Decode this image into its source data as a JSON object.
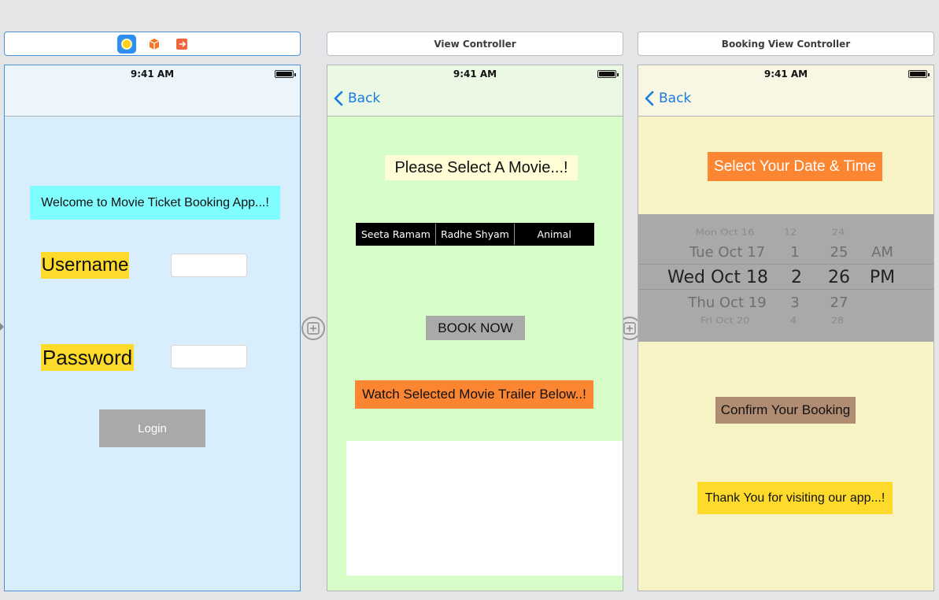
{
  "scenes": {
    "login": {
      "time": "9:41 AM",
      "welcome": "Welcome to Movie Ticket Booking App...!",
      "username_label": "Username",
      "password_label": "Password",
      "username_value": "",
      "password_value": "",
      "login_button": "Login"
    },
    "view_controller": {
      "title": "View Controller",
      "time": "9:41 AM",
      "back": "Back",
      "heading": "Please Select A Movie...!",
      "segments": [
        "Seeta Ramam",
        "Radhe Shyam",
        "Animal"
      ],
      "book_button": "BOOK NOW",
      "trailer_label": "Watch Selected Movie Trailer Below..!"
    },
    "booking": {
      "title": "Booking View Controller",
      "time": "9:41 AM",
      "back": "Back",
      "heading": "Select Your Date & Time",
      "picker": {
        "dates": [
          "Mon Oct 16",
          "Tue Oct 17",
          "Wed Oct 18",
          "Thu Oct 19",
          "Fri Oct 20"
        ],
        "hours": [
          "12",
          "1",
          "2",
          "3",
          "4"
        ],
        "minutes": [
          "24",
          "25",
          "26",
          "27",
          "28"
        ],
        "ampm": [
          "",
          "AM",
          "PM",
          "",
          ""
        ]
      },
      "confirm": "Confirm Your Booking",
      "thanks": "Thank You for visiting our app...!"
    }
  },
  "colors": {
    "canvas": "#e4e5e7",
    "login_bg": "#d8eefc",
    "movie_bg": "#d7fdc8",
    "booking_bg": "#f7f3c4",
    "cyan_label": "#7ffdff",
    "yellow_label": "#fedb2b",
    "orange": "#fc8532",
    "gray_button": "#a9a9a9",
    "tan": "#b08c73",
    "ios_blue": "#1a7be0"
  },
  "icons": [
    "view-controller-icon",
    "first-responder-icon",
    "exit-icon",
    "back-chevron-icon",
    "segue-icon"
  ]
}
